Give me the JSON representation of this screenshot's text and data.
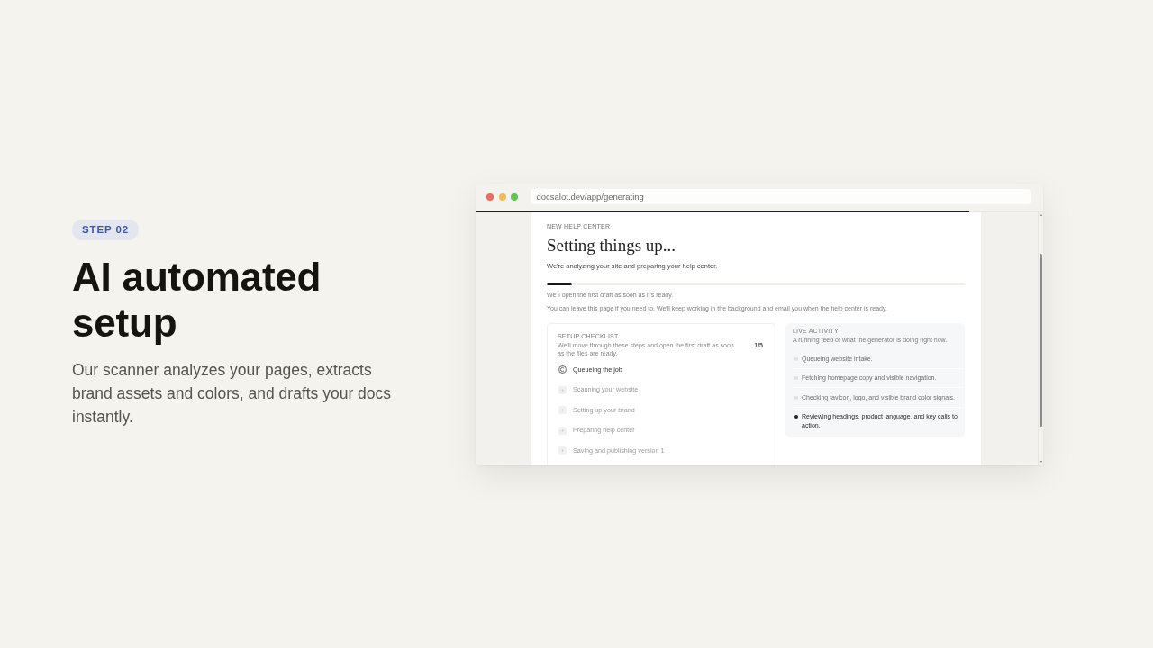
{
  "intro": {
    "badge": "STEP 02",
    "headline": "AI automated setup",
    "description": "Our scanner analyzes your pages, extracts brand assets and colors, and drafts your docs instantly."
  },
  "browser": {
    "url": "docsalot.dev/app/generating",
    "loading": {
      "level": 0.87
    }
  },
  "page": {
    "eyebrow": "NEW HELP CENTER",
    "title": "Setting things up...",
    "subtitle": "We're analyzing your site and preparing your help center.",
    "progress": {
      "level": 0.06
    },
    "notes": [
      "We'll open the first draft as soon as it's ready.",
      "You can leave this page if you need to. We'll keep working in the background and email you when the help center is ready."
    ]
  },
  "checklist": {
    "label": "SETUP CHECKLIST",
    "description": "We'll move through these steps and open the first draft as soon as the files are ready.",
    "count": "1/5",
    "items": [
      {
        "label": "Queueing the job",
        "active": true
      },
      {
        "label": "Scanning your website",
        "active": false
      },
      {
        "label": "Setting up your brand",
        "active": false
      },
      {
        "label": "Preparing help center",
        "active": false
      },
      {
        "label": "Saving and publishing version 1",
        "active": false
      }
    ]
  },
  "activity": {
    "label": "LIVE ACTIVITY",
    "description": "A running feed of what the generator is doing right now.",
    "items": [
      {
        "text": "Queueing website intake.",
        "current": false
      },
      {
        "text": "Fetching homepage copy and visible navigation.",
        "current": false
      },
      {
        "text": "Checking favicon, logo, and visible brand color signals.",
        "current": false
      },
      {
        "text": "Reviewing headings, product language, and key calls to action.",
        "current": true
      }
    ]
  }
}
